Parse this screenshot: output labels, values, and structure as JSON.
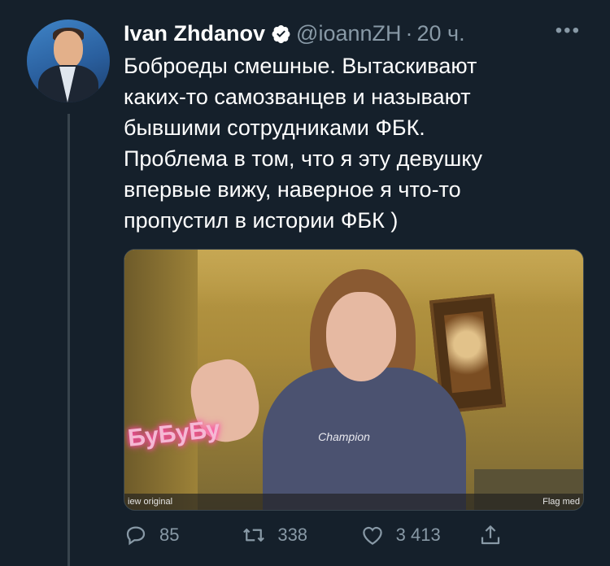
{
  "tweet": {
    "author_name": "Ivan Zhdanov",
    "handle": "@ioannZH",
    "separator": "·",
    "time": "20 ч.",
    "text": "Боброеды смешные. Вытаскивают\nкаких-то самозванцев и называют\nбывшими сотрудниками ФБК.\nПроблема в том, что я эту девушку\nвпервые вижу, наверное я что-то\nпропустил в истории ФБК  )"
  },
  "media": {
    "overlay_text": "БуБуБу",
    "hoodie_text": "Champion",
    "view_original": "iew original",
    "flag_media": "Flag med"
  },
  "actions": {
    "reply_count": "85",
    "retweet_count": "338",
    "like_count": "3 413"
  },
  "icons": {
    "verified": "verified-badge-icon",
    "more": "more-options-icon",
    "reply": "reply-icon",
    "retweet": "retweet-icon",
    "like": "like-icon",
    "share": "share-icon"
  },
  "colors": {
    "background": "#15202b",
    "secondary_text": "#8899a6",
    "primary_text": "#ffffff",
    "divider": "#38444d"
  }
}
